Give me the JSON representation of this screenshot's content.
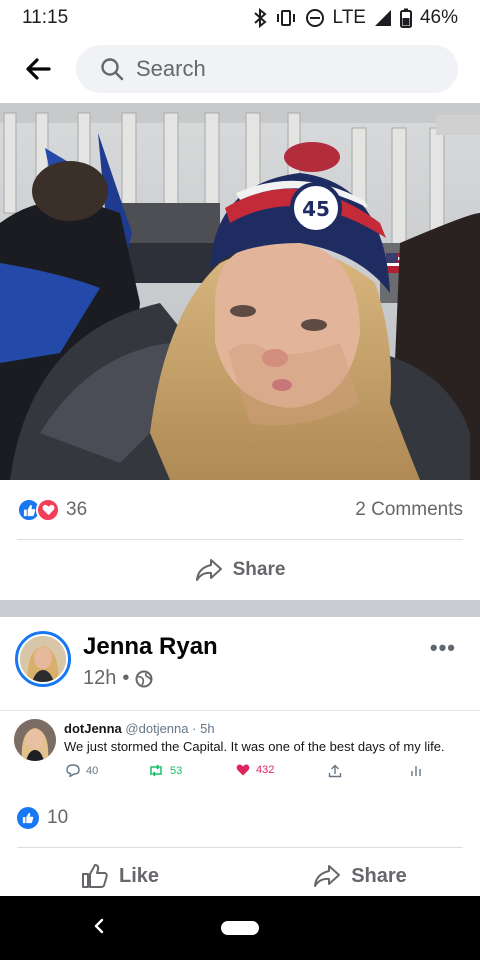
{
  "status_bar": {
    "time": "11:15",
    "network": "LTE",
    "battery": "46%"
  },
  "search": {
    "placeholder": "Search"
  },
  "post": {
    "reaction_count": "36",
    "comments": "2 Comments",
    "share_label": "Share"
  },
  "shared_post": {
    "author": "Jenna Ryan",
    "time": "12h",
    "tweet": {
      "name": "dotJenna",
      "handle": "@dotjenna",
      "time": "5h",
      "text": "We just stormed the Capital. It was one of the best days of my life.",
      "replies": "40",
      "retweets": "53",
      "likes": "432"
    },
    "like_count": "10",
    "actions": {
      "like": "Like",
      "share": "Share"
    }
  },
  "colors": {
    "brand": "#1877f2",
    "love": "#f33e58",
    "retweet": "#17bf63",
    "heart": "#e0245e"
  }
}
